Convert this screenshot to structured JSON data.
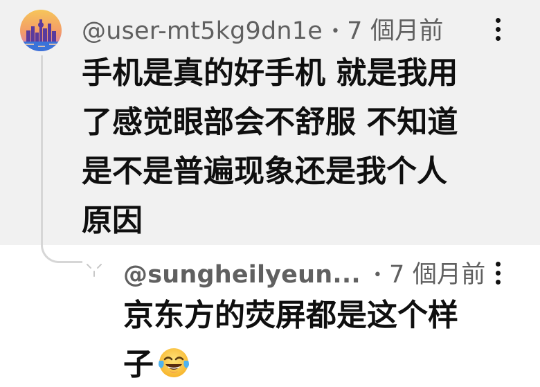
{
  "comment": {
    "username": "@user-mt5kg9dn1e",
    "separator": "•",
    "timestamp": "7 個月前",
    "text_lines": [
      "手机是真的好手机 就是我用",
      "了感觉眼部会不舒服 不知道",
      "是不是普遍现象还是我个人",
      "原因"
    ],
    "avatar_icon": "city-skyline-avatar",
    "more_icon": "more-vertical-icon"
  },
  "reply": {
    "username": "@sungheilyeun...",
    "separator": "•",
    "timestamp": "7 個月前",
    "text_lines": [
      "京东方的荧屏都是这个样",
      "子"
    ],
    "emoji": "face-with-tears-of-joy-emoji",
    "more_icon": "more-vertical-icon"
  },
  "colors": {
    "comment_background": "#f1f1f1",
    "text_primary": "#0f0f0f",
    "text_secondary": "#606060",
    "thread_line": "#d6d6d6"
  }
}
